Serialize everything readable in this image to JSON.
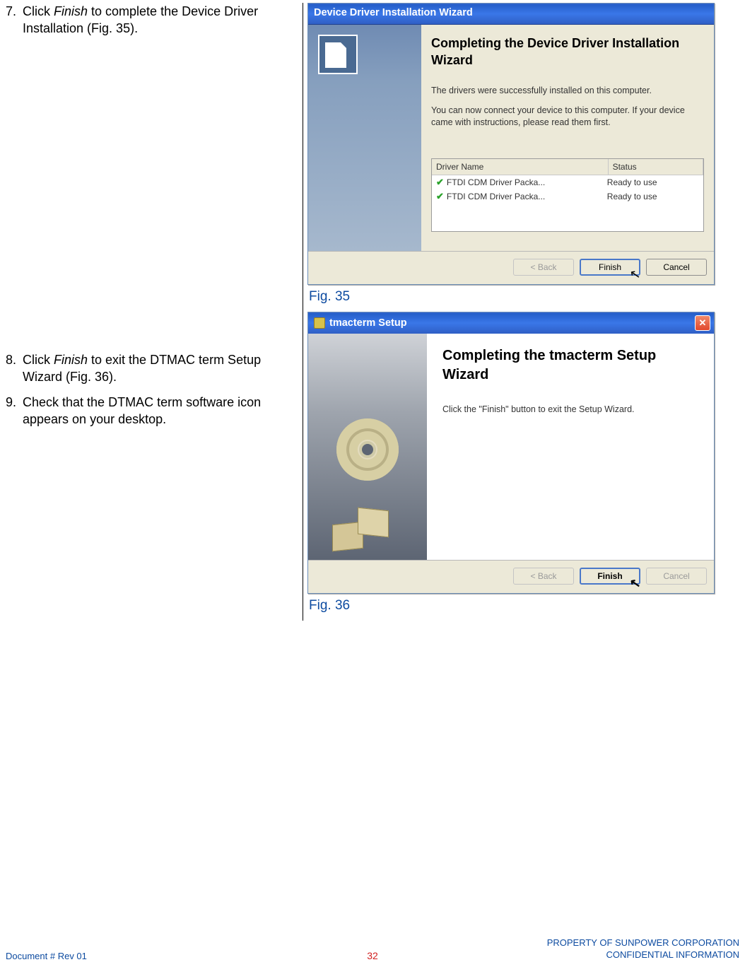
{
  "steps": [
    {
      "num": "7.",
      "pre": "Click ",
      "ital": "Finish",
      "post": " to complete the Device Driver Installation (Fig. 35)."
    },
    {
      "num": "8.",
      "pre": "Click ",
      "ital": "Finish",
      "post": " to exit the DTMAC term Setup Wizard (Fig. 36)."
    },
    {
      "num": "9.",
      "pre": "",
      "ital": "",
      "post": "Check that the DTMAC term software icon appears on your desktop."
    }
  ],
  "wiz1": {
    "title": "Device Driver Installation Wizard",
    "heading": "Completing the Device Driver Installation Wizard",
    "line1": "The drivers were successfully installed on this computer.",
    "line2": "You can now connect your device to this computer. If your device came with instructions, please read them first.",
    "table": {
      "col1": "Driver Name",
      "col2": "Status",
      "rows": [
        {
          "name": "FTDI CDM Driver Packa...",
          "status": "Ready to use"
        },
        {
          "name": "FTDI CDM Driver Packa...",
          "status": "Ready to use"
        }
      ]
    },
    "buttons": {
      "back": "< Back",
      "finish": "Finish",
      "cancel": "Cancel"
    }
  },
  "fig35": "Fig. 35",
  "wiz2": {
    "title": "tmacterm Setup",
    "heading": "Completing the tmacterm Setup Wizard",
    "line1": "Click the \"Finish\" button to exit the Setup Wizard.",
    "buttons": {
      "back": "< Back",
      "finish": "Finish",
      "cancel": "Cancel"
    }
  },
  "fig36": "Fig. 36",
  "footer": {
    "left": "Document #  Rev 01",
    "center": "32",
    "right1": "PROPERTY OF SUNPOWER CORPORATION",
    "right2": "CONFIDENTIAL INFORMATION"
  }
}
